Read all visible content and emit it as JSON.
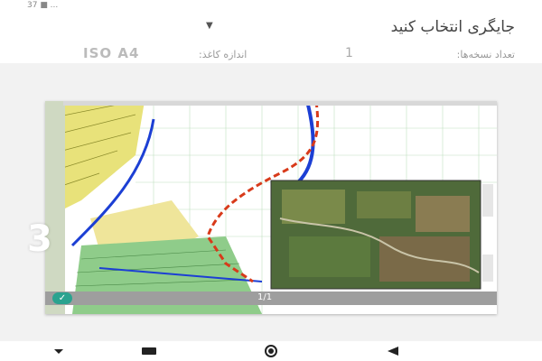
{
  "status_bar": {
    "left_text": "37 ■ ...",
    "right_text": ""
  },
  "header": {
    "title": "جایگری انتخاب کنید",
    "copies_label": "تعداد نسخه‌ها:",
    "copies_value": "1",
    "paper_size_label": "اندازه کاغذ:",
    "paper_size_value": "ISO A4"
  },
  "preview": {
    "page_indicator": "1/1",
    "overlay_number": "3"
  },
  "icons": {
    "title_dropdown": "chevron-down-icon",
    "expand": "chevron-down-icon",
    "check": "check-icon",
    "nav_recent": "recent-apps-icon",
    "nav_home": "home-icon",
    "nav_back": "back-icon",
    "nav_menu": "menu-icon"
  },
  "colors": {
    "check_badge": "#2aa38f",
    "map_yellow": "#e8e27a",
    "map_green": "#7ec07a",
    "map_blue": "#1c3fd4",
    "map_red_dash": "#d83a1a"
  }
}
